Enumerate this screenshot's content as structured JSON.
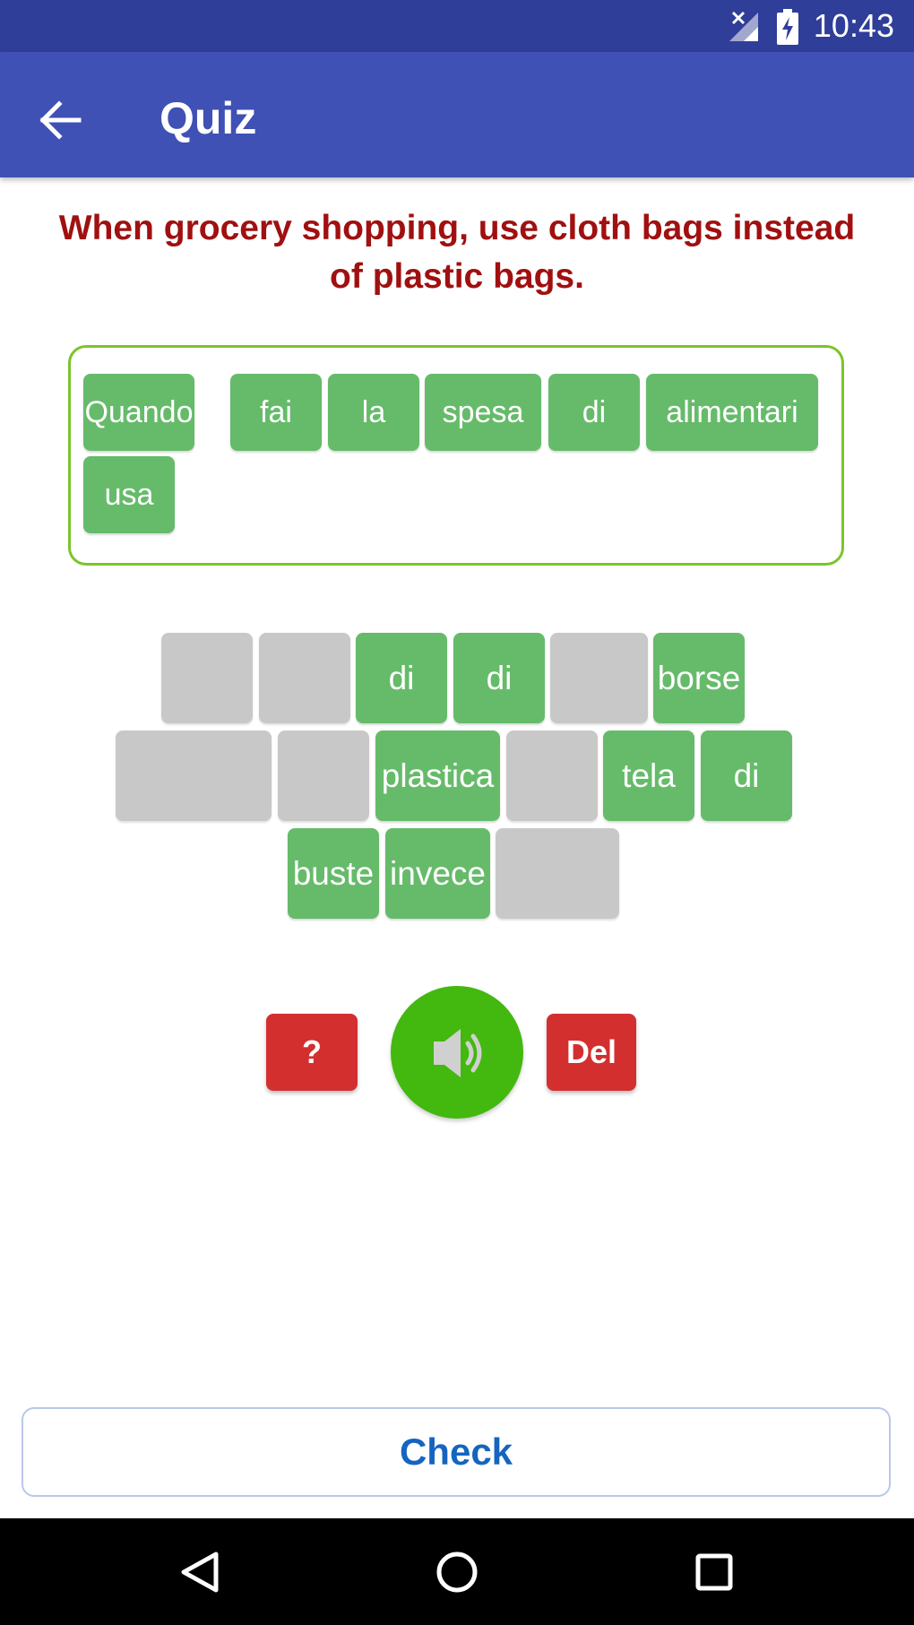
{
  "status_bar": {
    "time": "10:43",
    "icons": [
      "signal-off-icon",
      "battery-charging-icon"
    ]
  },
  "app_bar": {
    "back_icon": "arrow-left-icon",
    "title": "Quiz"
  },
  "prompt": "When grocery shopping, use cloth bags instead of plastic bags.",
  "answer_words": [
    "Quando",
    "fai",
    "la",
    "spesa",
    "di",
    "alimentari",
    "usa"
  ],
  "word_bank": [
    {
      "word": "",
      "used": true
    },
    {
      "word": "",
      "used": true
    },
    {
      "word": "di",
      "used": false
    },
    {
      "word": "di",
      "used": false
    },
    {
      "word": "",
      "used": true
    },
    {
      "word": "borse",
      "used": false
    },
    {
      "word": "",
      "used": true
    },
    {
      "word": "",
      "used": true
    },
    {
      "word": "plastica",
      "used": false
    },
    {
      "word": "",
      "used": true
    },
    {
      "word": "tela",
      "used": false
    },
    {
      "word": "di",
      "used": false
    },
    {
      "word": "buste",
      "used": false
    },
    {
      "word": "invece",
      "used": false
    },
    {
      "word": "",
      "used": true
    }
  ],
  "controls": {
    "hint_label": "?",
    "speaker_icon": "speaker-icon",
    "delete_label": "Del"
  },
  "check_label": "Check",
  "nav_bar": {
    "icons": [
      "back-triangle-icon",
      "home-circle-icon",
      "recents-square-icon"
    ]
  },
  "colors": {
    "status_bar": "#2f3e98",
    "app_bar": "#3f51b5",
    "prompt_text": "#a01010",
    "chip": "#66bb6a",
    "chip_empty": "#c8c8c8",
    "answer_border": "#7cc42a",
    "red_button": "#d32f2f",
    "speaker": "#43b80f",
    "check_text": "#1565c0"
  }
}
